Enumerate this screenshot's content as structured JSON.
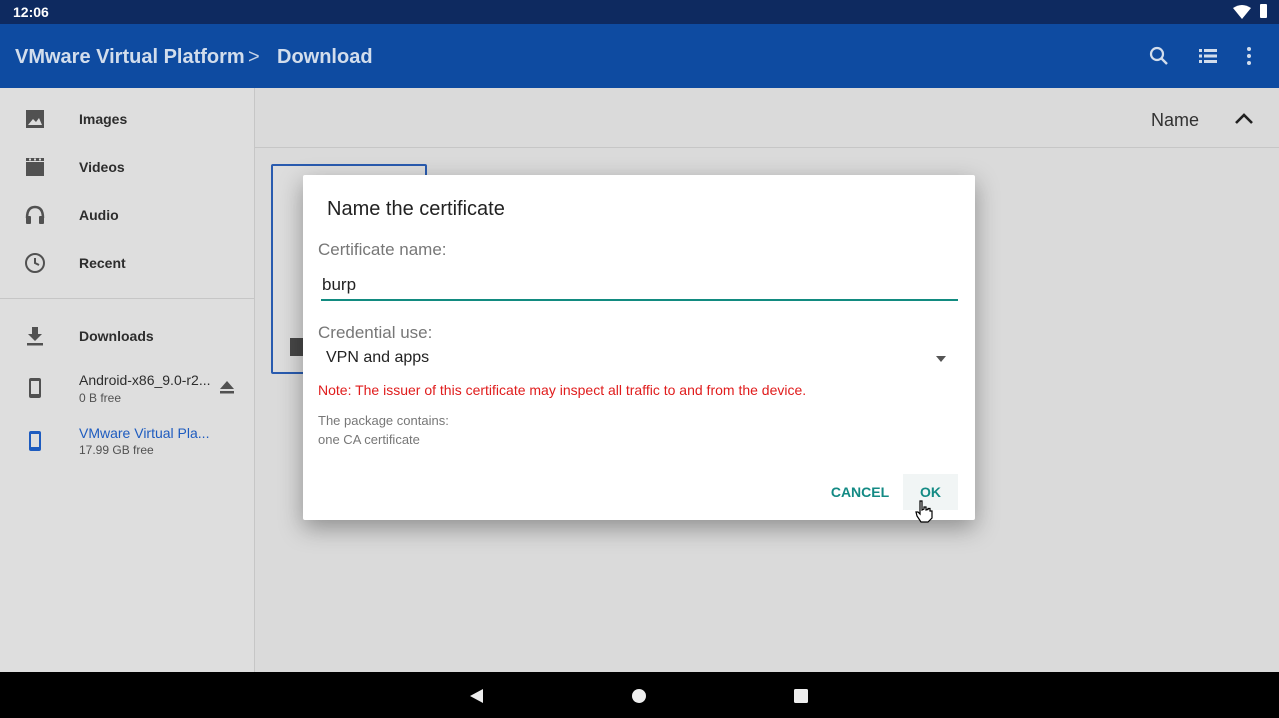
{
  "status": {
    "time": "12:06"
  },
  "appbar": {
    "crumb_root": "VMware Virtual Platform",
    "crumb_sep": ">",
    "crumb_current": "Download"
  },
  "sidebar": {
    "items": [
      {
        "label": "Images",
        "icon": "image-icon"
      },
      {
        "label": "Videos",
        "icon": "film-icon"
      },
      {
        "label": "Audio",
        "icon": "headphones-icon"
      },
      {
        "label": "Recent",
        "icon": "clock-icon"
      },
      {
        "label": "Downloads",
        "icon": "download-icon"
      },
      {
        "label": "Android-x86_9.0-r2...",
        "sub": "0 B free",
        "icon": "phone-icon"
      },
      {
        "label": "VMware Virtual Pla...",
        "sub": "17.99 GB free",
        "icon": "phone-icon"
      }
    ]
  },
  "content": {
    "sort_label": "Name"
  },
  "dialog": {
    "title": "Name the certificate",
    "name_label": "Certificate name:",
    "name_value": "burp",
    "use_label": "Credential use:",
    "use_value": "VPN and apps",
    "note": "Note: The issuer of this certificate may inspect all traffic to and from the device.",
    "info_line1": "The package contains:",
    "info_line2": "one CA certificate",
    "cancel_label": "CANCEL",
    "ok_label": "OK"
  },
  "colors": {
    "appbar": "#0f4fa8",
    "status": "#0e2a60",
    "accent": "#138a84",
    "warning": "#e01c1c",
    "selected": "#2b5fb7"
  }
}
